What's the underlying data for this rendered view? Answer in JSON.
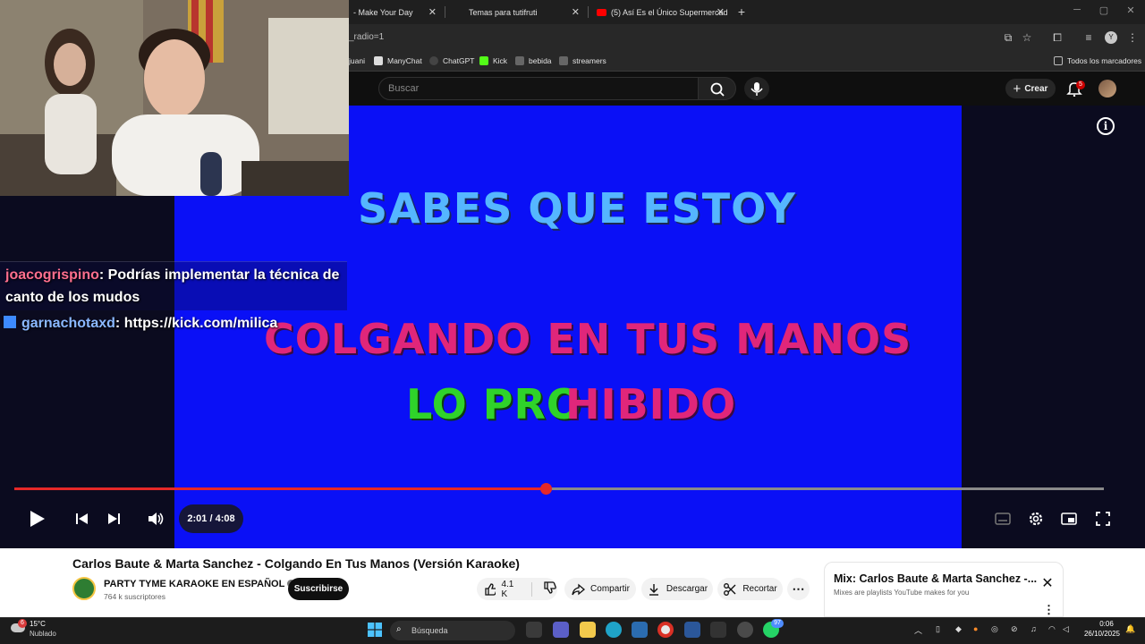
{
  "tabs": [
    {
      "label": "- Make Your Day"
    },
    {
      "label": "Temas para tutifruti"
    },
    {
      "label": "(5) Así Es el Único Supermercad"
    }
  ],
  "omnibox": {
    "url": "_radio=1"
  },
  "bookmarks": {
    "items": [
      "juani",
      "ManyChat",
      "ChatGPT",
      "Kick",
      "bebida",
      "streamers"
    ],
    "all_label": "Todos los marcadores"
  },
  "yt_header": {
    "search_placeholder": "Buscar",
    "create_label": "Crear",
    "notifications_count": "5"
  },
  "lyrics": {
    "line1": "SABES QUE ESTOY",
    "line2": "COLGANDO EN TUS MANOS",
    "line3_sung": "LO PRO",
    "line3_pending": "HIBIDO"
  },
  "player": {
    "time_display": "2:01 / 4:08",
    "progress_fraction": 0.488
  },
  "chat": [
    {
      "user": "joacogrispino",
      "text": ": Podrías implementar la técnica de canto de los mudos",
      "user_color": "#ff6f8e"
    },
    {
      "user": "garnachotaxd",
      "text": ": https://kick.com/milica",
      "user_color": "#8ab8ff"
    }
  ],
  "video": {
    "title": "Carlos Baute & Marta Sanchez - Colgando En Tus Manos (Versión Karaoke)",
    "channel": "PARTY TYME KARAOKE EN ESPAÑOL",
    "subscribers": "764 k suscriptores",
    "subscribe_label": "Suscribirse",
    "likes": "4.1 K",
    "share_label": "Compartir",
    "download_label": "Descargar",
    "clip_label": "Recortar"
  },
  "mix": {
    "title": "Mix: Carlos Baute & Marta Sanchez -...",
    "subtitle": "Mixes are playlists YouTube makes for you"
  },
  "taskbar": {
    "weather_badge": "6",
    "temperature": "15°C",
    "condition": "Nublado",
    "search_placeholder": "Búsqueda",
    "whatsapp_badge": "97",
    "time": "0:06",
    "date": "26/10/2025"
  }
}
